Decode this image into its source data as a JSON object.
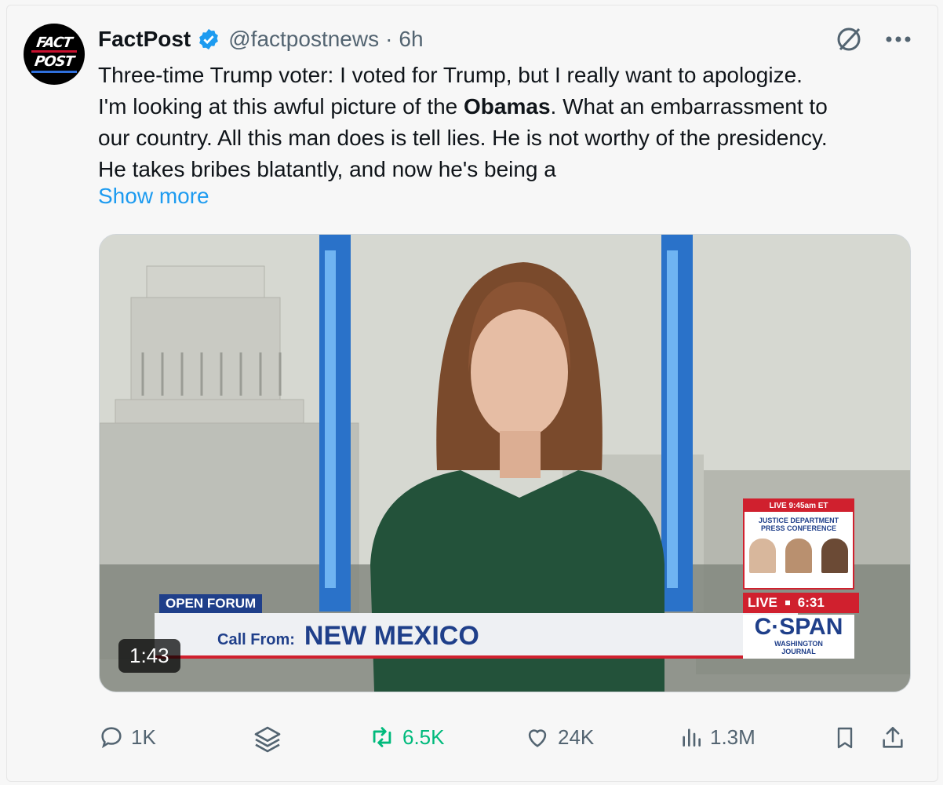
{
  "post": {
    "author_name": "FactPost",
    "handle": "@factpostnews",
    "separator": "·",
    "time": "6h",
    "avatar_line1": "FACT",
    "avatar_line2": "POST",
    "text_line1": "Three-time Trump voter: I voted for Trump, but I really want to apologize.",
    "text_line2_a": "I'm looking at this awful picture of the ",
    "text_line2_b": "Obamas",
    "text_line2_c": ". What an embarrassment to",
    "text_line3": "our country. All this man does is tell lies. He is not worthy of the presidency.",
    "text_line4": "He takes bribes blatantly, and now he's being a",
    "show_more": "Show more"
  },
  "media": {
    "duration": "1:43",
    "lower_third_tag": "OPEN FORUM",
    "call_from_label": "Call From:",
    "call_from_value": "NEW MEXICO",
    "inset_header": "LIVE 9:45am ET",
    "inset_title_1": "JUSTICE DEPARTMENT",
    "inset_title_2": "PRESS CONFERENCE",
    "live_label": "LIVE",
    "live_time": "6:31",
    "network": "C·SPAN",
    "show_1": "WASHINGTON",
    "show_2": "JOURNAL"
  },
  "actions": {
    "replies": "1K",
    "reposts": "6.5K",
    "likes": "24K",
    "views": "1.3M"
  },
  "colors": {
    "accent": "#1d9bf0",
    "repost": "#00ba7c",
    "muted": "#536471",
    "cspan_blue": "#1f3f8a",
    "live_red": "#d0202e"
  },
  "icons": [
    "verified-badge-icon",
    "grok-icon",
    "more-icon",
    "reply-icon",
    "layers-icon",
    "repost-icon",
    "like-icon",
    "views-icon",
    "bookmark-icon",
    "share-icon"
  ]
}
